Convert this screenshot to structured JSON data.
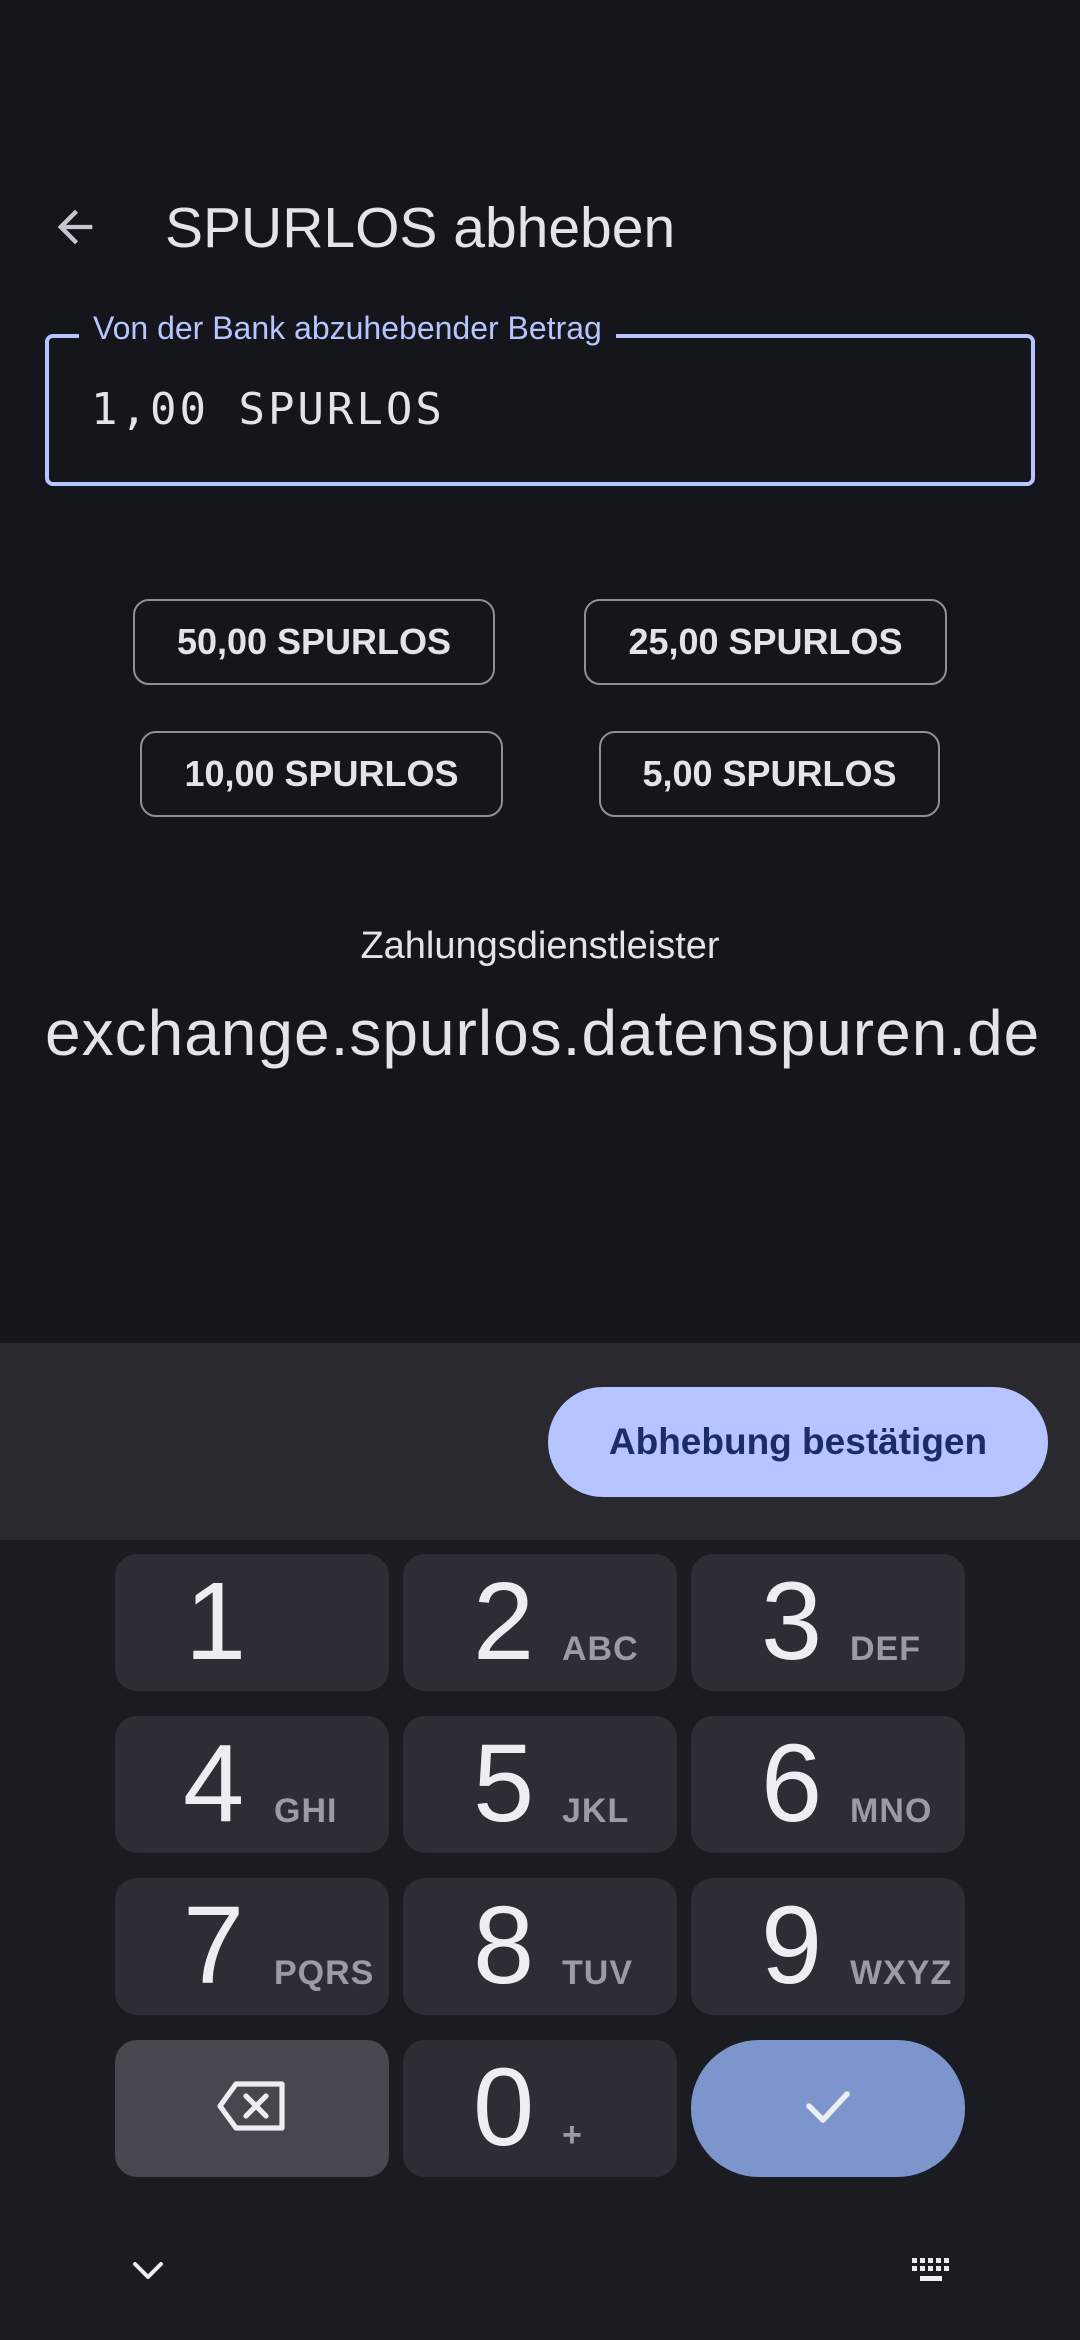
{
  "toolbar": {
    "title": "SPURLOS abheben",
    "back_icon": "arrow-back-icon"
  },
  "amount_field": {
    "label": "Von der Bank abzuhebender Betrag",
    "value": "1,00 SPURLOS"
  },
  "preset_amounts": [
    {
      "label": "50,00 SPURLOS"
    },
    {
      "label": "25,00 SPURLOS"
    },
    {
      "label": "10,00 SPURLOS"
    },
    {
      "label": "5,00 SPURLOS"
    }
  ],
  "provider": {
    "label": "Zahlungsdienstleister",
    "value": "exchange.spurlos.datenspuren.de"
  },
  "confirm": {
    "label": "Abhebung bestätigen"
  },
  "keypad": {
    "keys": [
      {
        "num": "1",
        "sub": ""
      },
      {
        "num": "2",
        "sub": "ABC"
      },
      {
        "num": "3",
        "sub": "DEF"
      },
      {
        "num": "4",
        "sub": "GHI"
      },
      {
        "num": "5",
        "sub": "JKL"
      },
      {
        "num": "6",
        "sub": "MNO"
      },
      {
        "num": "7",
        "sub": "PQRS"
      },
      {
        "num": "8",
        "sub": "TUV"
      },
      {
        "num": "9",
        "sub": "WXYZ"
      },
      {
        "num": "0",
        "sub": "+"
      }
    ],
    "delete_icon": "backspace-icon",
    "done_icon": "checkmark-icon",
    "hide_icon": "chevron-down-icon",
    "switch_icon": "keyboard-icon"
  },
  "colors": {
    "accent": "#b6c4ff",
    "background": "#14161c",
    "confirm_bar": "#2b2930",
    "done_key": "#7c95cc"
  }
}
